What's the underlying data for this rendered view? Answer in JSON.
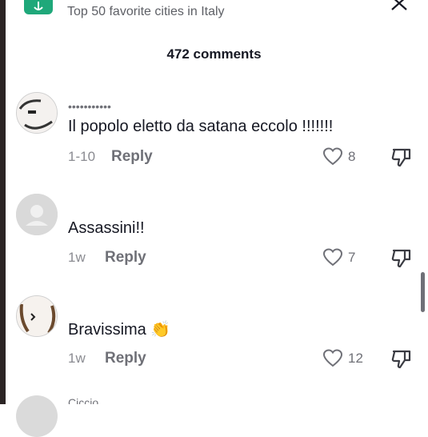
{
  "header": {
    "title": "Top 50 favorite cities in Italy",
    "comments_label": "472 comments"
  },
  "colors": {
    "accent": "#1fa87a",
    "text": "#161823",
    "muted": "#6f7077"
  },
  "comments": [
    {
      "username": "•••••••••••",
      "text": "Il popolo eletto da satana eccolo !!!!!!!",
      "time": "1-10",
      "reply_label": "Reply",
      "likes": "8"
    },
    {
      "username": "",
      "text": "Assassini!!",
      "time": "1w",
      "reply_label": "Reply",
      "likes": "7"
    },
    {
      "username": "",
      "text": "Bravissima",
      "emoji": "👏",
      "time": "1w",
      "reply_label": "Reply",
      "likes": "12"
    },
    {
      "username": "Ciccio",
      "text": ""
    }
  ]
}
